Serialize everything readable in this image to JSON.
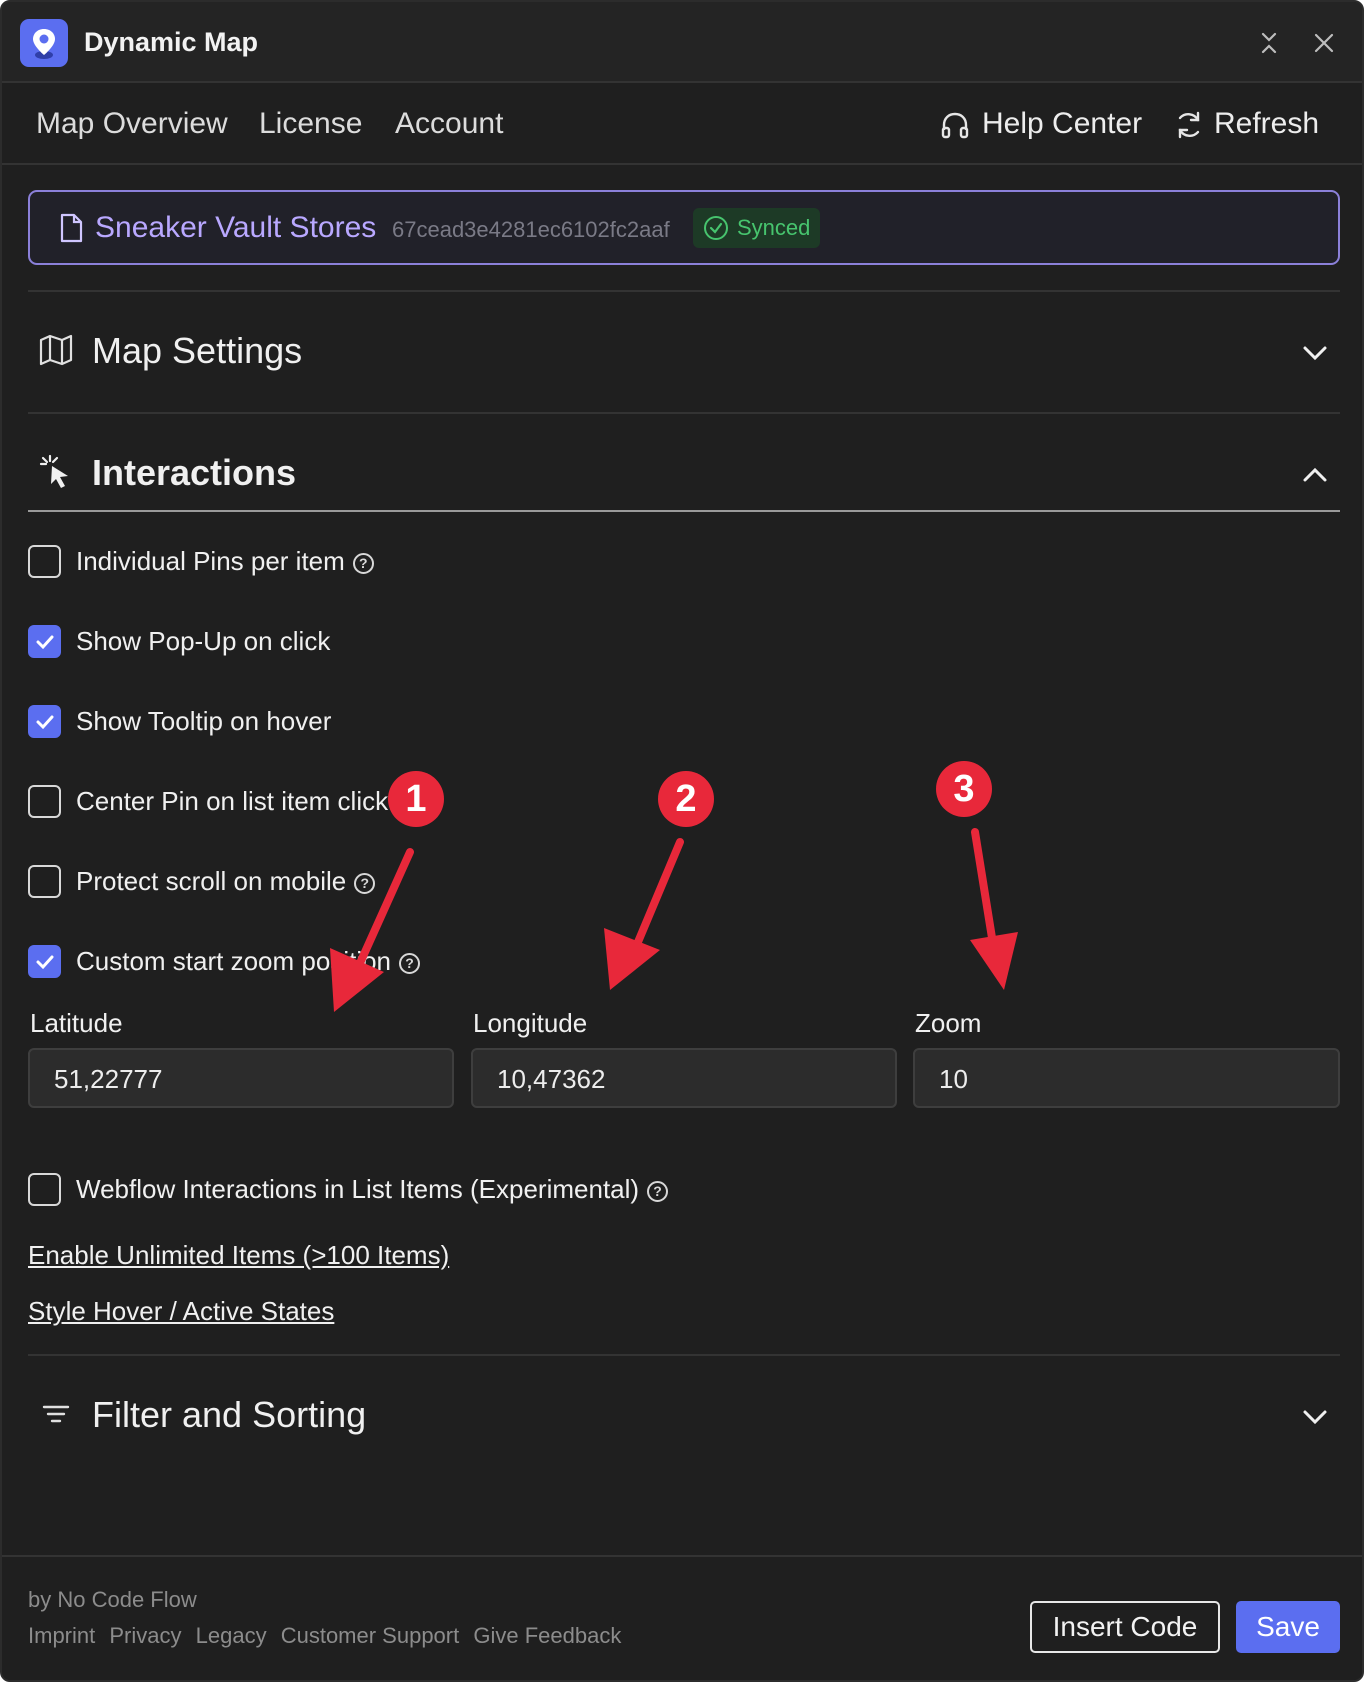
{
  "app": {
    "title": "Dynamic Map"
  },
  "nav": {
    "tabs": [
      {
        "label": "Map Overview"
      },
      {
        "label": "License"
      },
      {
        "label": "Account"
      }
    ],
    "help_center": "Help Center",
    "refresh": "Refresh"
  },
  "collection": {
    "name": "Sneaker Vault Stores",
    "id": "67cead3e4281ec6102fc2aaf",
    "status": "Synced"
  },
  "sections": {
    "map_settings": "Map Settings",
    "interactions": "Interactions",
    "filter_sorting": "Filter and Sorting"
  },
  "options": [
    {
      "label": "Individual Pins per item",
      "checked": false,
      "help": true
    },
    {
      "label": "Show Pop-Up on click",
      "checked": true,
      "help": false
    },
    {
      "label": "Show Tooltip on hover",
      "checked": true,
      "help": false
    },
    {
      "label": "Center Pin on list item click",
      "checked": false,
      "help": false
    },
    {
      "label": "Protect scroll on mobile",
      "checked": false,
      "help": true
    },
    {
      "label": "Custom start zoom position",
      "checked": true,
      "help": true
    },
    {
      "label": "Webflow Interactions in List Items (Experimental)",
      "checked": false,
      "help": true
    }
  ],
  "fields": {
    "latitude": {
      "label": "Latitude",
      "value": "51,22777"
    },
    "longitude": {
      "label": "Longitude",
      "value": "10,47362"
    },
    "zoom": {
      "label": "Zoom",
      "value": "10"
    }
  },
  "links": {
    "unlimited": "Enable Unlimited Items (>100 Items)",
    "style_states": "Style Hover / Active States"
  },
  "footer": {
    "by": "by No Code Flow",
    "links": [
      "Imprint",
      "Privacy",
      "Legacy",
      "Customer Support",
      "Give Feedback"
    ],
    "insert_code": "Insert Code",
    "save": "Save"
  },
  "annotations": {
    "badges": [
      "1",
      "2",
      "3"
    ],
    "color": "#e8283a"
  },
  "colors": {
    "accent": "#5b6ef0",
    "synced": "#47c46e",
    "collection": "#b9a8ff"
  }
}
